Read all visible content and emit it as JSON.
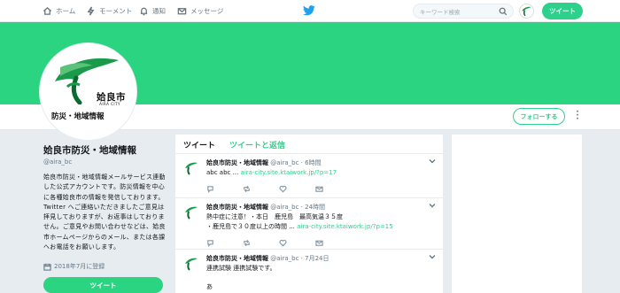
{
  "nav": {
    "home": "ホーム",
    "moments": "モーメント",
    "notifications": "通知",
    "messages": "メッセージ",
    "search_placeholder": "キーワード検索",
    "tweet_button": "ツイート"
  },
  "profile": {
    "avatar_name": "姶良市",
    "avatar_sub": "AIRA CITY",
    "avatar_tag": "防災・地域情報",
    "name": "姶良市防災・地域情報",
    "handle": "@aira_bc",
    "bio": "姶良市防災・地域情報メールサービス連動した公式アカウントです。防災情報を中心に各種姶良市の情報を発信しております。Twitter へご連絡いただきましたご意見は拝見しておりますが、お返事はしておりません。ご意見やお問い合わせなどは、姶良市ホームページからのメール、または各課へお電話をお願いします。",
    "joined": "2018年7月に登録",
    "tweet_button": "ツイート",
    "follow_button": "フォローする",
    "more": "⋮"
  },
  "colors": {
    "accent": "#2dd18c",
    "banner": "#2ad481",
    "logo_green": "#1a9a4a",
    "logo_dark": "#0a6b31"
  },
  "timeline": {
    "tab_tweets": "ツイート",
    "tab_replies": "ツイートと返信",
    "tweets": [
      {
        "name": "姶良市防災・地域情報",
        "handle": "@aira_bc",
        "time": "6時間",
        "text": "abc abc ...",
        "link": "aira-city.site.ktaiwork.jp/?p=17"
      },
      {
        "name": "姶良市防災・地域情報",
        "handle": "@aira_bc",
        "time": "24時間",
        "text": "熱中症に注意！・本日　鹿児島　最高気温３５度\n・鹿児島で３０度以上の時間 ...",
        "link": "aira-city.site.ktaiwork.jp/?p=15"
      },
      {
        "name": "姶良市防災・地域情報",
        "handle": "@aira_bc",
        "time": "7月24日",
        "text": "連携試験 連携試験です。",
        "extra": "あ"
      }
    ]
  }
}
